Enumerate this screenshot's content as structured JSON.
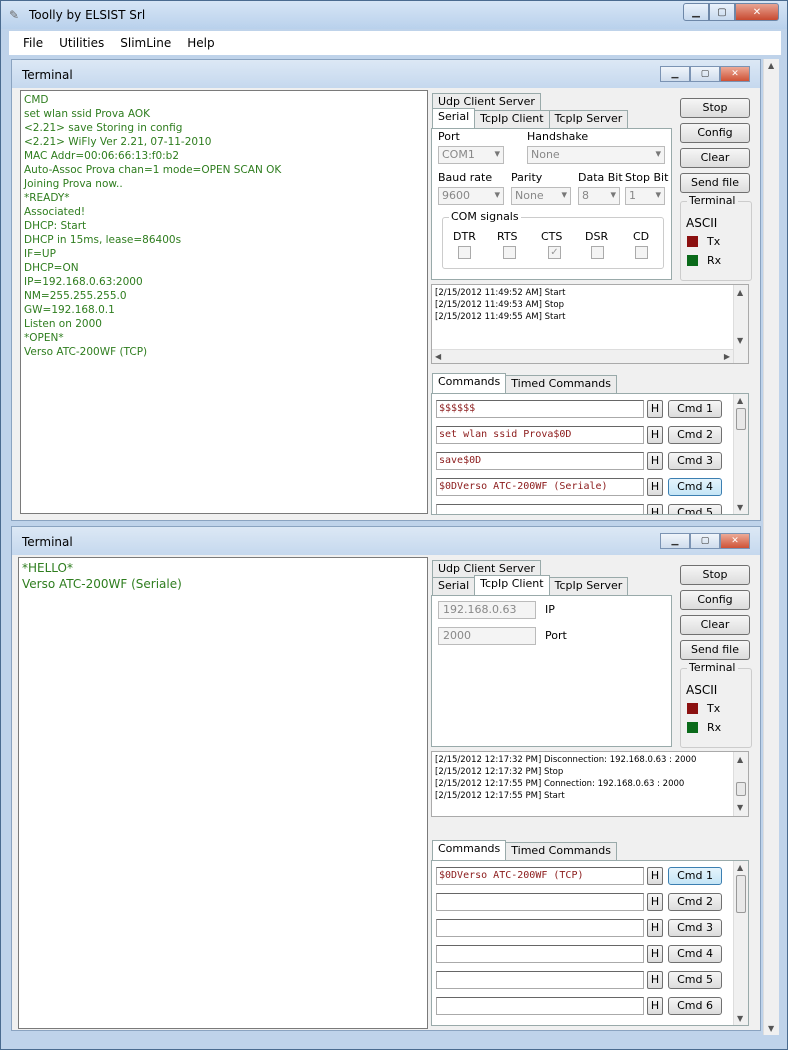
{
  "app": {
    "title": "Toolly by ELSIST Srl",
    "menu": [
      "File",
      "Utilities",
      "SlimLine",
      "Help"
    ]
  },
  "top": {
    "title": "Terminal",
    "terminal_lines": [
      "CMD",
      "set wlan ssid Prova AOK",
      "<2.21> save Storing in config",
      "<2.21> WiFly Ver 2.21, 07-11-2010",
      "MAC Addr=00:06:66:13:f0:b2",
      "Auto-Assoc Prova chan=1 mode=OPEN SCAN OK",
      "Joining Prova now..",
      "*READY*",
      "Associated!",
      "DHCP: Start",
      "DHCP in 15ms, lease=86400s",
      "IF=UP",
      "DHCP=ON",
      "IP=192.168.0.63:2000",
      "NM=255.255.255.0",
      "GW=192.168.0.1",
      "Listen on 2000",
      "*OPEN*",
      "Verso ATC-200WF (TCP)"
    ],
    "tabs_row1": [
      "Udp Client Server"
    ],
    "tabs_row2": [
      "Serial",
      "TcpIp Client",
      "TcpIp Server"
    ],
    "serial": {
      "port_label": "Port",
      "port_value": "COM1",
      "handshake_label": "Handshake",
      "handshake_value": "None",
      "baud_label": "Baud rate",
      "baud_value": "9600",
      "parity_label": "Parity",
      "parity_value": "None",
      "databit_label": "Data Bit",
      "databit_value": "8",
      "stopbit_label": "Stop Bit",
      "stopbit_value": "1",
      "com_signals_label": "COM signals",
      "signals": [
        "DTR",
        "RTS",
        "CTS",
        "DSR",
        "CD"
      ],
      "cts_checked": "✓"
    },
    "buttons": [
      "Stop",
      "Config",
      "Clear",
      "Send file"
    ],
    "terminal_group": {
      "label": "Terminal",
      "mode": "ASCII",
      "tx": "Tx",
      "rx": "Rx"
    },
    "log": [
      "[2/15/2012 11:49:52 AM] Start",
      "[2/15/2012 11:49:53 AM] Stop",
      "[2/15/2012 11:49:55 AM] Start"
    ],
    "cmd_tabs": [
      "Commands",
      "Timed Commands"
    ],
    "commands": [
      {
        "value": "$$$$$$",
        "h": "H",
        "button": "Cmd 1"
      },
      {
        "value": "set wlan ssid Prova$0D",
        "h": "H",
        "button": "Cmd 2"
      },
      {
        "value": "save$0D",
        "h": "H",
        "button": "Cmd 3"
      },
      {
        "value": "$0DVerso ATC-200WF (Seriale)",
        "h": "H",
        "button": "Cmd 4"
      },
      {
        "value": "",
        "h": "H",
        "button": "Cmd 5"
      }
    ]
  },
  "bottom": {
    "title": "Terminal",
    "terminal_lines": [
      "*HELLO*",
      "Verso ATC-200WF (Seriale)"
    ],
    "tabs_row1": [
      "Udp Client Server"
    ],
    "tabs_row2": [
      "Serial",
      "TcpIp Client",
      "TcpIp Server"
    ],
    "tcp": {
      "ip_value": "192.168.0.63",
      "ip_label": "IP",
      "port_value": "2000",
      "port_label": "Port"
    },
    "buttons": [
      "Stop",
      "Config",
      "Clear",
      "Send file"
    ],
    "terminal_group": {
      "label": "Terminal",
      "mode": "ASCII",
      "tx": "Tx",
      "rx": "Rx"
    },
    "log": [
      "[2/15/2012 12:17:32 PM] Disconnection: 192.168.0.63 : 2000",
      "[2/15/2012 12:17:32 PM] Stop",
      "[2/15/2012 12:17:55 PM] Connection: 192.168.0.63 : 2000",
      "[2/15/2012 12:17:55 PM] Start"
    ],
    "cmd_tabs": [
      "Commands",
      "Timed Commands"
    ],
    "commands": [
      {
        "value": "$0DVerso ATC-200WF (TCP)",
        "h": "H",
        "button": "Cmd 1"
      },
      {
        "value": "",
        "h": "H",
        "button": "Cmd 2"
      },
      {
        "value": "",
        "h": "H",
        "button": "Cmd 3"
      },
      {
        "value": "",
        "h": "H",
        "button": "Cmd 4"
      },
      {
        "value": "",
        "h": "H",
        "button": "Cmd 5"
      },
      {
        "value": "",
        "h": "H",
        "button": "Cmd 6"
      }
    ]
  },
  "colors": {
    "terminal_text": "#2e7d1e",
    "command_text": "#8b1a1a",
    "tx": "#8b1010",
    "rx": "#0a6a1a"
  }
}
